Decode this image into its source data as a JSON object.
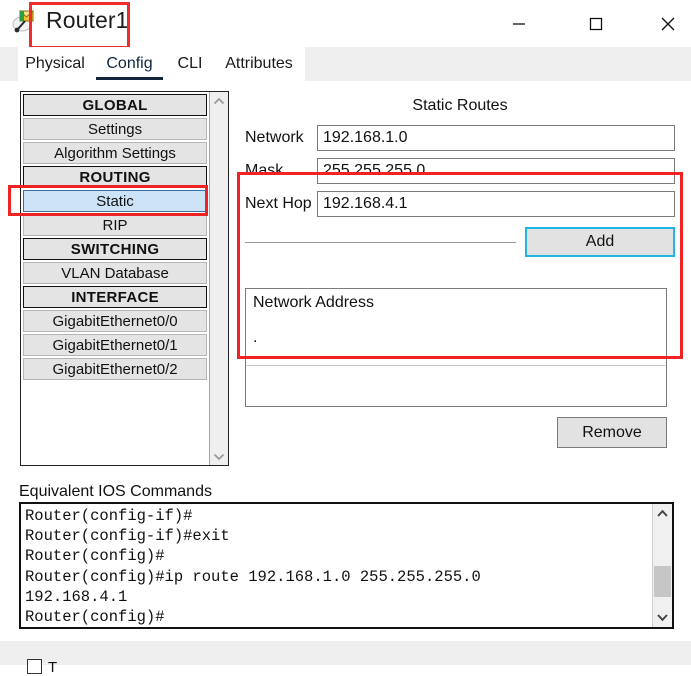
{
  "window": {
    "title": "Router1",
    "icon": "router-packet-icon",
    "controls": {
      "minimize": "minimize-icon",
      "maximize": "maximize-icon",
      "close": "close-icon"
    }
  },
  "tabs": [
    {
      "label": "Physical",
      "selected": false
    },
    {
      "label": "Config",
      "selected": true
    },
    {
      "label": "CLI",
      "selected": false
    },
    {
      "label": "Attributes",
      "selected": false
    }
  ],
  "sidebar": {
    "items": [
      {
        "label": "GLOBAL",
        "type": "header"
      },
      {
        "label": "Settings",
        "type": "item"
      },
      {
        "label": "Algorithm Settings",
        "type": "item"
      },
      {
        "label": "ROUTING",
        "type": "header"
      },
      {
        "label": "Static",
        "type": "item",
        "selected": true
      },
      {
        "label": "RIP",
        "type": "item"
      },
      {
        "label": "SWITCHING",
        "type": "header"
      },
      {
        "label": "VLAN Database",
        "type": "item"
      },
      {
        "label": "INTERFACE",
        "type": "header"
      },
      {
        "label": "GigabitEthernet0/0",
        "type": "item"
      },
      {
        "label": "GigabitEthernet0/1",
        "type": "item"
      },
      {
        "label": "GigabitEthernet0/2",
        "type": "item"
      }
    ],
    "scroll_up": "chevron-up-icon",
    "scroll_down": "chevron-down-icon"
  },
  "static_routes": {
    "title": "Static Routes",
    "fields": [
      {
        "label": "Network",
        "value": "192.168.1.0",
        "placeholder": ""
      },
      {
        "label": "Mask",
        "value": "255.255.255.0",
        "placeholder": ""
      },
      {
        "label": "Next Hop",
        "value": "192.168.4.1",
        "placeholder": ""
      }
    ],
    "add_label": "Add"
  },
  "route_list": {
    "column_header": "Network Address",
    "rows": [
      "."
    ],
    "remove_label": "Remove"
  },
  "ios": {
    "label": "Equivalent IOS Commands",
    "text": "Router(config-if)#\nRouter(config-if)#exit\nRouter(config)#\nRouter(config)#ip route 192.168.1.0 255.255.255.0\n192.168.4.1\nRouter(config)#",
    "scroll_up": "chevron-up-icon",
    "scroll_down": "chevron-down-icon"
  },
  "footer": {
    "checkbox_label": "T"
  },
  "annotations": {
    "color": "#ee2424",
    "boxes": [
      "window-title",
      "sidebar-static-item",
      "static-routes-panel"
    ]
  },
  "colors": {
    "accent_selected_item": "#cde3f7",
    "focus_border": "#1fb6e3",
    "tab_underline": "#14233c",
    "annotation_red": "#ee2424",
    "button_face": "#e2e2e2"
  }
}
